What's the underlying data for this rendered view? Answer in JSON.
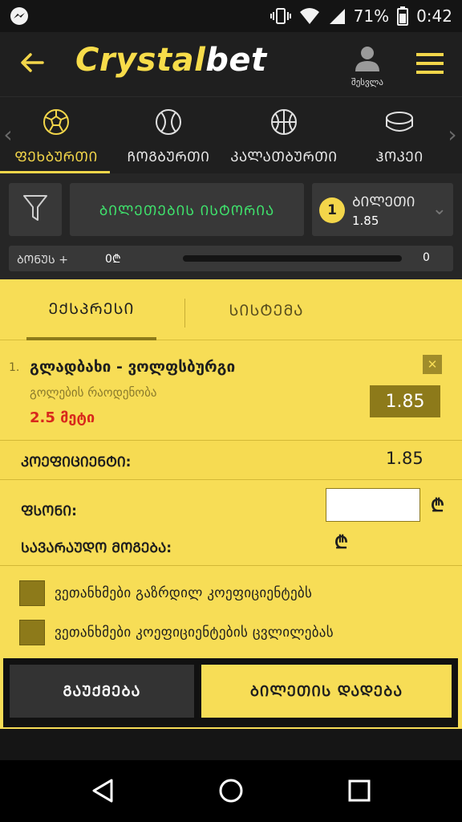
{
  "status_bar": {
    "battery": "71%",
    "time": "0:42"
  },
  "app": {
    "logo_part1": "Crystal",
    "logo_part2": "bet",
    "account_label": "შესვლა"
  },
  "sports": [
    {
      "label": "ᲤᲔᲮᲑᲣᲠᲗᲘ",
      "icon": "soccer-ball-icon",
      "active": true
    },
    {
      "label": "ᲩᲝᲒᲑᲣᲠᲗᲘ",
      "icon": "tennis-ball-icon",
      "active": false
    },
    {
      "label": "ᲙᲐᲚᲐᲗᲑᲣᲠᲗᲘ",
      "icon": "basketball-icon",
      "active": false
    },
    {
      "label": "ᲰᲝᲙᲔᲘ",
      "icon": "hockey-puck-icon",
      "active": false
    }
  ],
  "tools": {
    "history_label": "ᲑᲘᲚᲔᲗᲔᲑᲘᲡ ᲘᲡᲢᲝᲠᲘᲐ",
    "ticket_count": "1",
    "ticket_label": "ᲑᲘᲚᲔᲗᲘ",
    "ticket_odd": "1.85"
  },
  "bonus": {
    "label": "ᲑᲝᲜᲣᲡ +",
    "amount": "0₾",
    "value": "0",
    "progress": 0
  },
  "betslip": {
    "tab_express": "ᲔᲥᲡᲞᲠᲔᲡᲘ",
    "tab_system": "ᲡᲘᲡᲢᲔᲛᲐ",
    "event": {
      "num": "1.",
      "title": "გლადბახი - ვოლფსბურგი",
      "market": "გოლების რაოდენობა",
      "pick": "2.5 მეტი",
      "odd": "1.85"
    },
    "coef_label": "ᲙᲝᲔᲤᲘᲪᲘᲔᲜᲢᲘ:",
    "coef_value": "1.85",
    "stake_label": "ᲤᲡᲝᲜᲘ:",
    "stake_value": "",
    "currency": "₾",
    "win_label": "ᲡᲐᲕᲐᲠᲐᲣᲓᲝ ᲛᲝᲒᲔᲑᲐ:",
    "check_increase": "ვეთანხმები გაზრდილ კოეფიციენტებს",
    "check_change": "ვეთანხმები კოეფიციენტების ცვლილებას",
    "cancel_label": "ᲒᲐᲣᲥᲛᲔᲑᲐ",
    "place_label": "ᲑᲘᲚᲔᲗᲘᲡ ᲓᲐᲓᲔᲑᲐ"
  },
  "colors": {
    "accent": "#f3d64a",
    "slip_bg": "#f7dd56",
    "green": "#3fe26c",
    "red": "#d8281c"
  }
}
